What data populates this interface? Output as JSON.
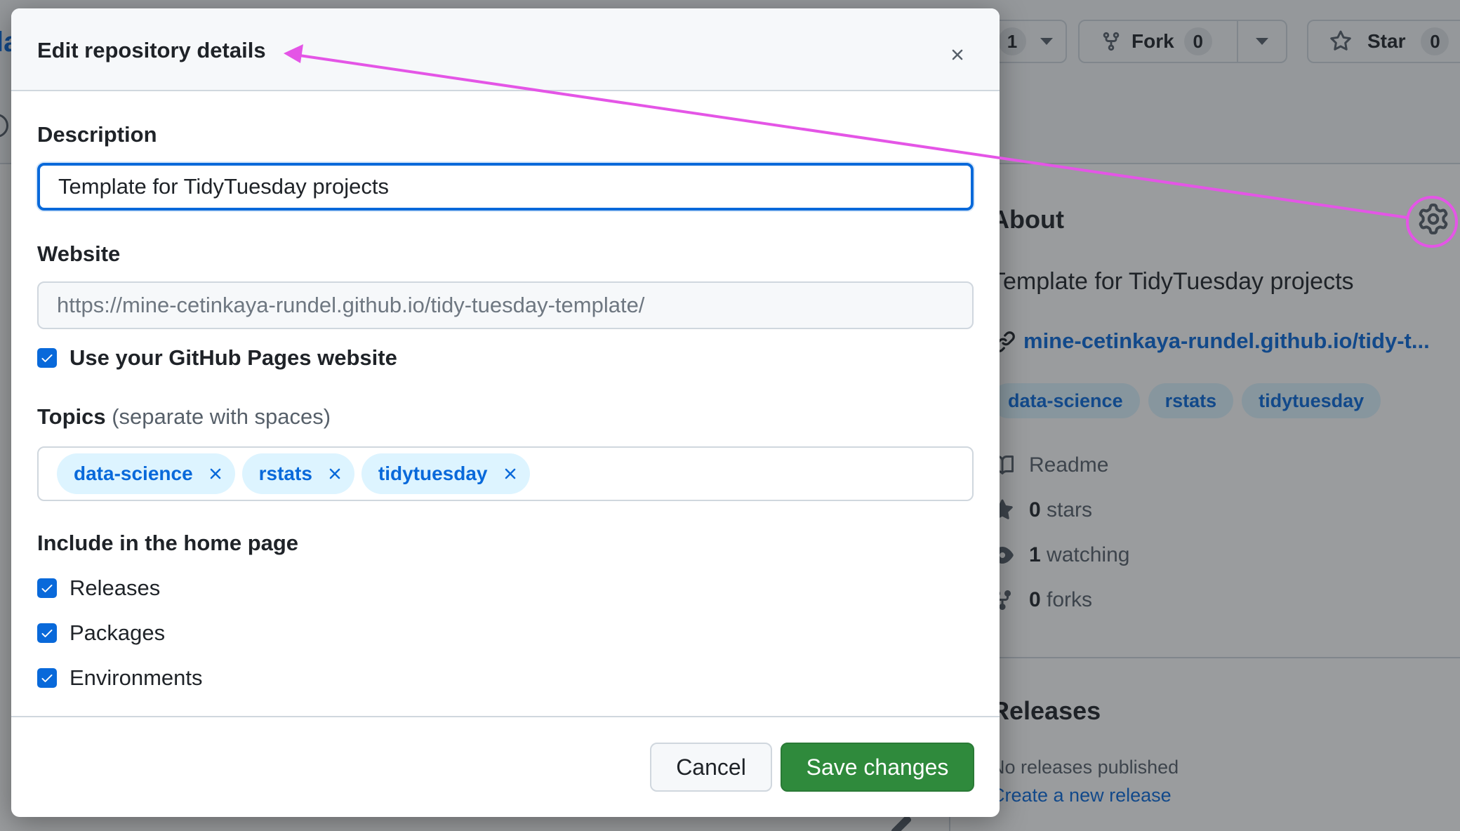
{
  "background": {
    "watch_count": "1",
    "fork": {
      "label": "Fork",
      "count": "0"
    },
    "star": {
      "label": "Star",
      "count": "0"
    },
    "about": {
      "title": "About",
      "description": "Template for TidyTuesday projects",
      "link": "mine-cetinkaya-rundel.github.io/tidy-t...",
      "topics": [
        "data-science",
        "rstats",
        "tidytuesday"
      ],
      "stats": [
        {
          "icon": "book-icon",
          "bold": "",
          "text": "Readme"
        },
        {
          "icon": "star-icon",
          "bold": "0",
          "text": "stars"
        },
        {
          "icon": "eye-icon",
          "bold": "1",
          "text": "watching"
        },
        {
          "icon": "fork-icon",
          "bold": "0",
          "text": "forks"
        }
      ]
    },
    "releases": {
      "title": "Releases",
      "none_text": "No releases published",
      "create_link": "Create a new release"
    }
  },
  "dialog": {
    "title": "Edit repository details",
    "description_label": "Description",
    "description_value": "Template for TidyTuesday projects",
    "website_label": "Website",
    "website_placeholder": "https://mine-cetinkaya-rundel.github.io/tidy-tuesday-template/",
    "use_pages_label": "Use your GitHub Pages website",
    "topics_label": "Topics",
    "topics_hint": "(separate with spaces)",
    "topics": [
      "data-science",
      "rstats",
      "tidytuesday"
    ],
    "homepage_label": "Include in the home page",
    "homepage_options": [
      "Releases",
      "Packages",
      "Environments"
    ],
    "cancel_label": "Cancel",
    "save_label": "Save changes"
  },
  "colors": {
    "accent": "#0969da",
    "save_button": "#2f8a3c",
    "annotation": "#e455e6",
    "topic_bg": "#ddf4ff"
  }
}
